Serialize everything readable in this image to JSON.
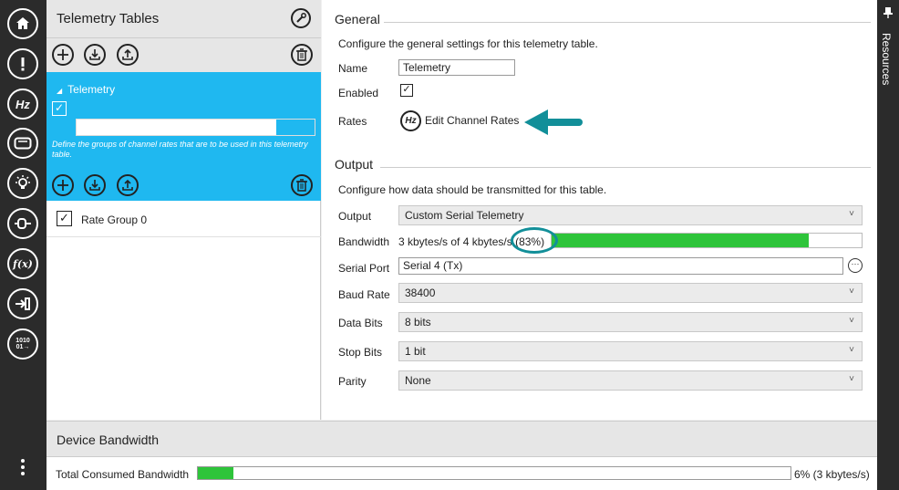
{
  "nav": {
    "items": [
      {
        "name": "home"
      },
      {
        "name": "alert"
      },
      {
        "name": "hz",
        "label": "Hz"
      },
      {
        "name": "display"
      },
      {
        "name": "light"
      },
      {
        "name": "connector"
      },
      {
        "name": "function",
        "label": "f(x)"
      },
      {
        "name": "input"
      },
      {
        "name": "binary",
        "label": "1010\n01→"
      }
    ]
  },
  "left_panel": {
    "title": "Telemetry Tables",
    "telemetry": {
      "name": "Telemetry",
      "checked": true,
      "description": "Define the groups of channel rates that are to be used in this telemetry table."
    },
    "rate_groups": [
      {
        "label": "Rate Group 0",
        "checked": true
      }
    ]
  },
  "general": {
    "title": "General",
    "description": "Configure the general settings for this telemetry table.",
    "name_label": "Name",
    "name_value": "Telemetry",
    "enabled_label": "Enabled",
    "enabled": true,
    "rates_label": "Rates",
    "edit_rates_label": "Edit Channel Rates"
  },
  "output": {
    "title": "Output",
    "description": "Configure how data should be transmitted for this table.",
    "output_label": "Output",
    "output_value": "Custom Serial Telemetry",
    "bandwidth_label": "Bandwidth",
    "bandwidth_text": "3 kbytes/s of 4 kbytes/s",
    "bandwidth_percent_text": "(83%)",
    "bandwidth_fraction": 0.83,
    "serial_port_label": "Serial Port",
    "serial_port_value": "Serial 4 (Tx)",
    "baud_rate_label": "Baud Rate",
    "baud_rate_value": "38400",
    "data_bits_label": "Data Bits",
    "data_bits_value": "8 bits",
    "stop_bits_label": "Stop Bits",
    "stop_bits_value": "1 bit",
    "parity_label": "Parity",
    "parity_value": "None"
  },
  "resources": {
    "label": "Resources"
  },
  "device_bandwidth": {
    "title": "Device Bandwidth",
    "total_label": "Total Consumed Bandwidth",
    "total_fraction": 0.06,
    "total_text": "6% (3 kbytes/s)"
  },
  "colors": {
    "accent": "#1fb8f0",
    "progress": "#2ec43a",
    "highlight": "#128f99"
  }
}
